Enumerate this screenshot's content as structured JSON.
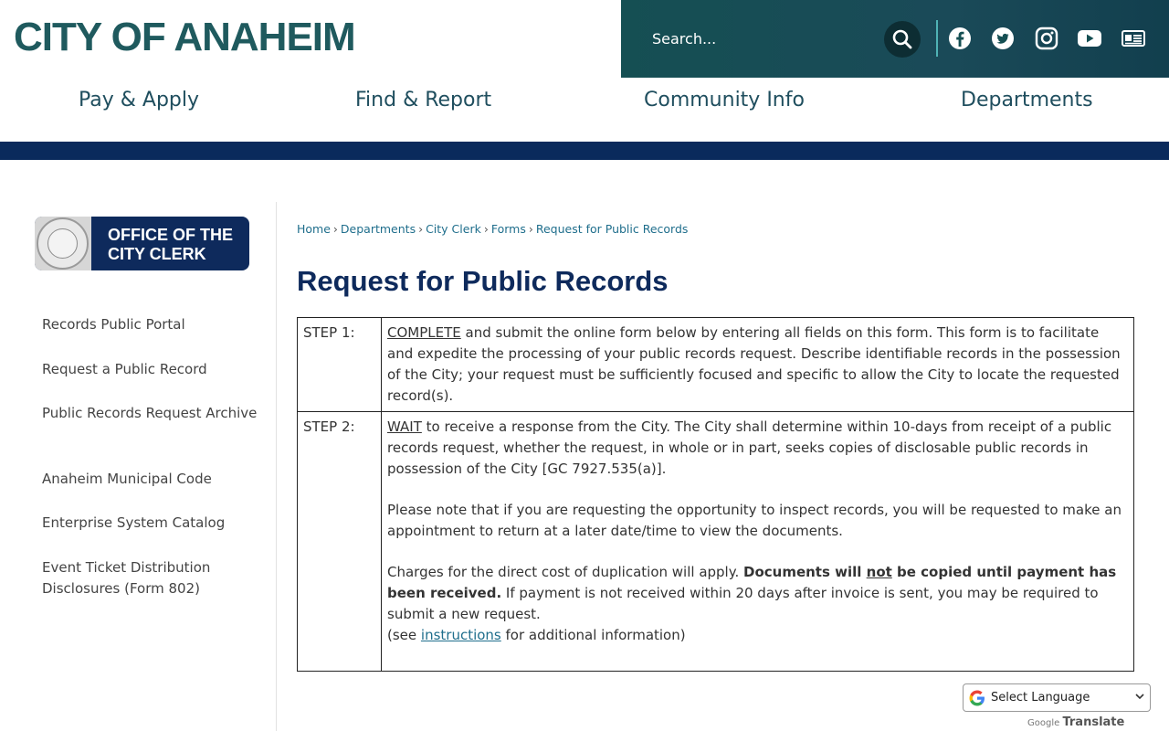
{
  "header": {
    "logo": "CITY OF ANAHEIM",
    "search_placeholder": "Search...",
    "social": [
      "facebook-icon",
      "twitter-icon",
      "instagram-icon",
      "youtube-icon",
      "news-icon"
    ],
    "nav": [
      "Pay & Apply",
      "Find & Report",
      "Community Info",
      "Departments"
    ]
  },
  "sidebar": {
    "badge_title": "OFFICE OF THE CITY CLERK",
    "links": [
      "Records Public Portal",
      "Request a Public Record",
      "Public Records Request Archive",
      "Anaheim Municipal Code",
      "Enterprise System Catalog",
      "Event Ticket Distribution Disclosures (Form 802)"
    ]
  },
  "breadcrumb": [
    "Home",
    "Departments",
    "City Clerk",
    "Forms",
    "Request for Public Records"
  ],
  "page_title": "Request for Public Records",
  "steps": {
    "step1_label": "STEP 1:",
    "step1_keyword": "COMPLETE",
    "step1_text": " and submit the online form below by entering all fields on this form. This form is to facilitate and expedite the processing of your public records request. Describe identifiable records in the possession of the City; your request must be sufficiently focused and specific to allow the City to locate the requested record(s).",
    "step2_label": "STEP 2:",
    "step2_keyword": "WAIT",
    "step2_text": " to receive a response from the City. The City shall determine within 10-days from receipt of a public records request, whether the request, in whole or in part, seeks copies of disclosable public records in possession of the City [GC 7927.535(a)].",
    "step2_para2": "Please note that if you are requesting the opportunity to inspect records, you will be requested to make an appointment to return at a later date/time to view the documents.",
    "step2_para3_a": "Charges for the direct cost of duplication will apply. ",
    "step2_para3_bold1": "Documents will ",
    "step2_para3_not": "not",
    "step2_para3_bold2": " be copied until payment has been received.",
    "step2_para3_c": " If payment is not received within 20 days after invoice is sent, you may be required to submit a new request.",
    "step2_see_a": "(see ",
    "step2_see_link": "instructions",
    "step2_see_b": " for additional information)"
  },
  "translate": {
    "label": "Select Language",
    "powered_by": "Google",
    "translate_word": "Translate"
  }
}
